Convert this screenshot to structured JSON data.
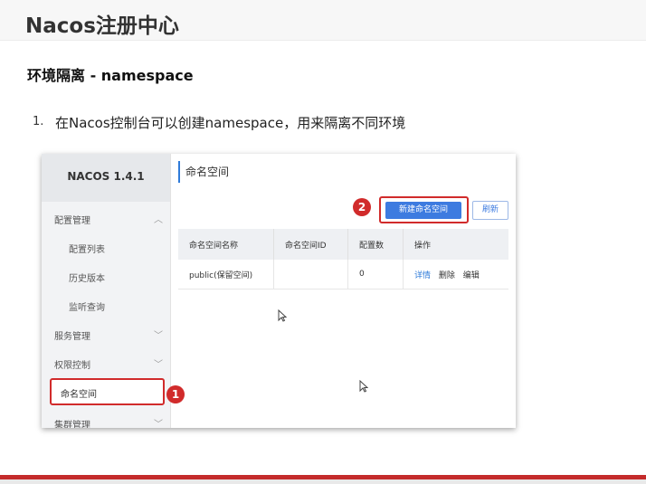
{
  "slide": {
    "title": "Nacos注册中心",
    "section": "环境隔离 - namespace",
    "step_number": "1.",
    "step_text": "在Nacos控制台可以创建namespace，用来隔离不同环境"
  },
  "console": {
    "logo": "NACOS 1.4.1",
    "sidebar": [
      {
        "label": "配置管理",
        "chevron": "^"
      },
      {
        "label": "配置列表"
      },
      {
        "label": "历史版本"
      },
      {
        "label": "监听查询"
      },
      {
        "label": "服务管理",
        "chevron": "v"
      },
      {
        "label": "权限控制",
        "chevron": "v"
      },
      {
        "label": "命名空间"
      },
      {
        "label": "集群管理",
        "chevron": "v"
      }
    ],
    "page_title": "命名空间",
    "new_button": "新建命名空间",
    "refresh_button": "刷新",
    "table": {
      "headers": [
        "命名空间名称",
        "命名空间ID",
        "配置数",
        "操作"
      ],
      "rows": [
        {
          "name": "public(保留空间)",
          "id": "",
          "count": "0",
          "ops": [
            "详情",
            "删除",
            "编辑"
          ]
        }
      ]
    }
  },
  "annotations": {
    "badge_1": "1",
    "badge_2": "2",
    "highlight_color": "#d12b2b"
  },
  "colors": {
    "accent": "#3d7be0",
    "footer": "#c42b2b"
  }
}
